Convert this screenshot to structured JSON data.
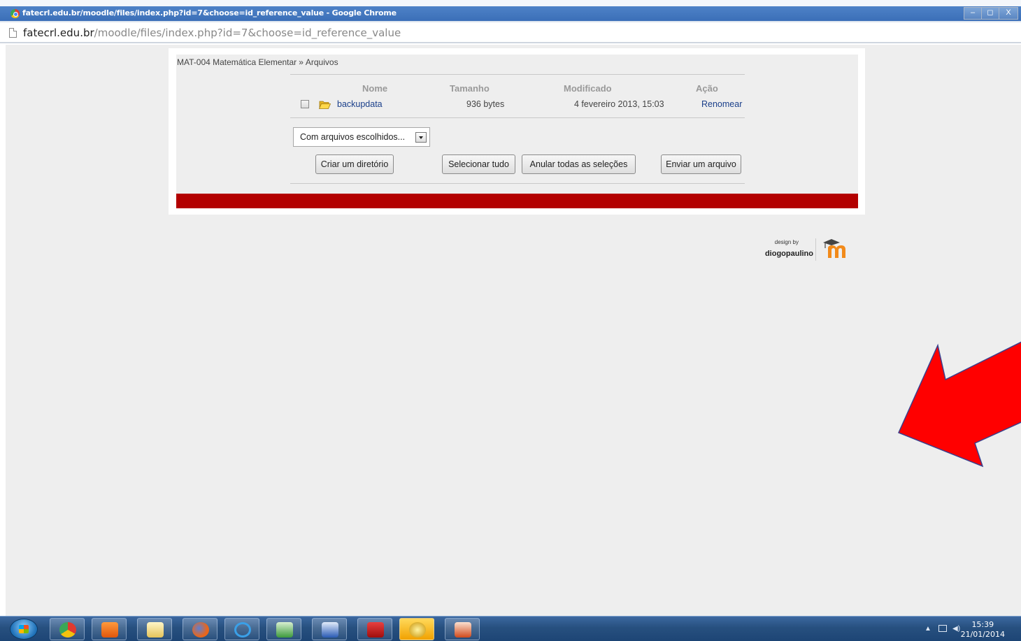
{
  "window": {
    "title": "fatecrl.edu.br/moodle/files/index.php?id=7&choose=id_reference_value - Google Chrome",
    "controls": {
      "minimize": "–",
      "maximize": "◻",
      "close": "X"
    }
  },
  "address": {
    "host": "fatecrl.edu.br",
    "path": "/moodle/files/index.php?id=7&choose=id_reference_value"
  },
  "breadcrumb": {
    "course": "MAT-004 Matemática Elementar",
    "separator": "»",
    "current": "Arquivos"
  },
  "table": {
    "headers": {
      "name": "Nome",
      "size": "Tamanho",
      "modified": "Modificado",
      "action": "Ação"
    },
    "rows": [
      {
        "name": "backupdata",
        "size": "936 bytes",
        "modified": "4 fevereiro 2013, 15:03",
        "action": "Renomear"
      }
    ]
  },
  "select": {
    "value": "Com arquivos escolhidos..."
  },
  "buttons": {
    "mkdir": "Criar um diretório",
    "select_all": "Selecionar tudo",
    "deselect_all": "Anular todas as seleções",
    "upload": "Enviar um arquivo"
  },
  "credit": {
    "design_by": "design by",
    "author": "diogopaulino"
  },
  "taskbar": {
    "apps": [
      "chrome",
      "media-player",
      "file-explorer",
      "firefox",
      "internet-explorer",
      "excel",
      "word",
      "acrobat",
      "app-yellow",
      "powerpoint"
    ],
    "time": "15:39",
    "date": "21/01/2014"
  },
  "colors": {
    "footer_bar": "#b30000",
    "callout_arrow": "#ff0000",
    "link": "#1a3f8a"
  }
}
